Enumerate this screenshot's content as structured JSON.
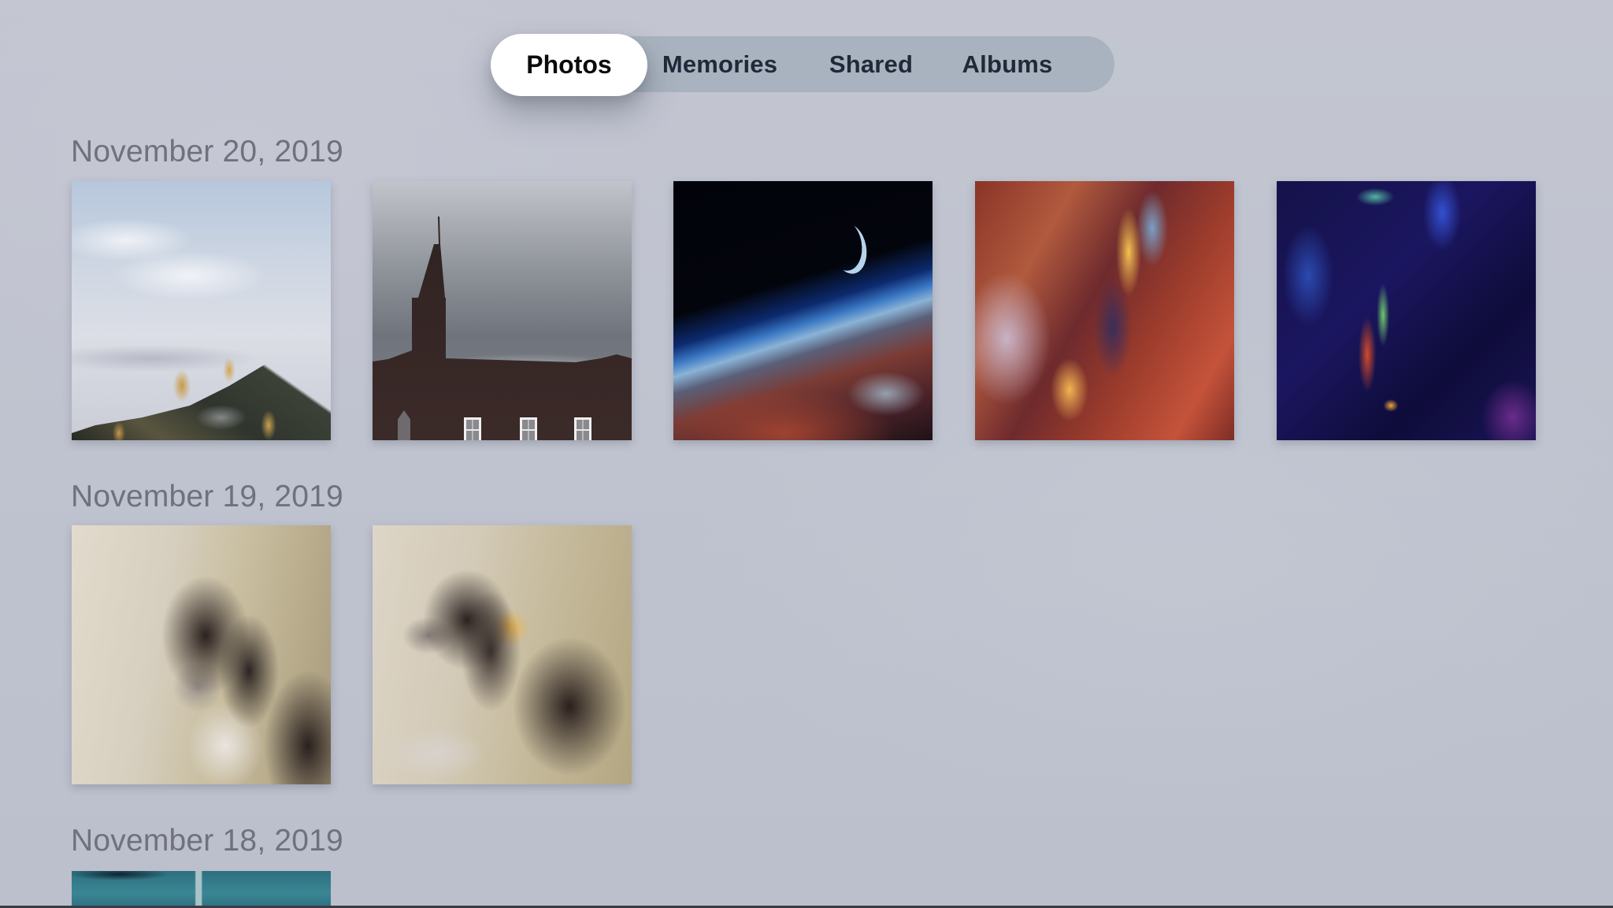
{
  "app": "Photos",
  "tabs": {
    "selected": "Photos",
    "items": [
      {
        "label": "Photos"
      },
      {
        "label": "Memories"
      },
      {
        "label": "Shared"
      },
      {
        "label": "Albums"
      }
    ]
  },
  "sections": [
    {
      "date": "November 20, 2019",
      "photos": [
        {
          "subject": "mountain-trees"
        },
        {
          "subject": "church-steeple"
        },
        {
          "subject": "earth-moon-space"
        },
        {
          "subject": "canyon-rocks"
        },
        {
          "subject": "fluid-art"
        }
      ]
    },
    {
      "date": "November 19, 2019",
      "photos": [
        {
          "subject": "dog-on-couch"
        },
        {
          "subject": "dog-on-couch-profile"
        }
      ]
    },
    {
      "date": "November 18, 2019",
      "photos": [
        {
          "subject": "teal-fabric"
        }
      ]
    }
  ]
}
